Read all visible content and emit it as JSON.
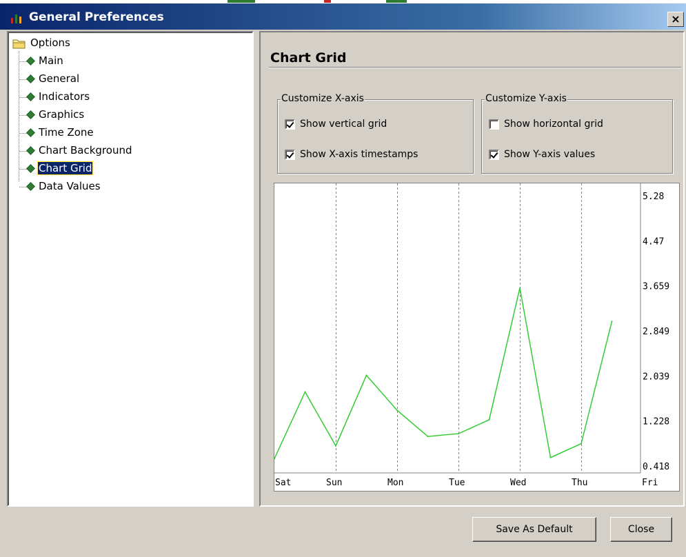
{
  "window": {
    "title": "General Preferences",
    "close_glyph": "×"
  },
  "tree": {
    "root_label": "Options",
    "items": [
      {
        "label": "Main"
      },
      {
        "label": "General"
      },
      {
        "label": "Indicators"
      },
      {
        "label": "Graphics"
      },
      {
        "label": "Time Zone"
      },
      {
        "label": "Chart Background"
      },
      {
        "label": "Chart Grid",
        "selected": true
      },
      {
        "label": "Data Values"
      }
    ]
  },
  "panel": {
    "title": "Chart Grid",
    "x_axis_group": {
      "legend": "Customize X-axis",
      "vertical_grid": {
        "label": "Show vertical grid",
        "checked": true
      },
      "timestamps": {
        "label": "Show X-axis timestamps",
        "checked": true
      }
    },
    "y_axis_group": {
      "legend": "Customize Y-axis",
      "horizontal_grid": {
        "label": "Show horizontal grid",
        "checked": false
      },
      "values": {
        "label": "Show Y-axis values",
        "checked": true
      }
    }
  },
  "chart_data": {
    "type": "line",
    "x_ticks": [
      "Sat",
      "Sun",
      "Mon",
      "Tue",
      "Wed",
      "Thu",
      "Fri"
    ],
    "y_ticks": [
      "5.28",
      "4.47",
      "3.659",
      "2.849",
      "2.039",
      "1.228",
      "0.418"
    ],
    "vertical_grid": true,
    "horizontal_grid": false,
    "line_color": "#33cc33",
    "x": [
      0,
      0.5,
      1,
      1.5,
      2,
      2.5,
      3,
      3.5,
      4,
      4.5,
      5,
      5.5
    ],
    "values": [
      0.55,
      1.75,
      0.78,
      2.05,
      1.42,
      0.95,
      1.0,
      1.25,
      3.62,
      0.57,
      0.82,
      3.02
    ],
    "ylim": [
      0.418,
      5.28
    ]
  },
  "buttons": {
    "save_default": "Save As Default",
    "close": "Close"
  },
  "colors": {
    "titlebar_start": "#0a246a",
    "selection": "#0a246a",
    "grid_line": "#808080"
  }
}
